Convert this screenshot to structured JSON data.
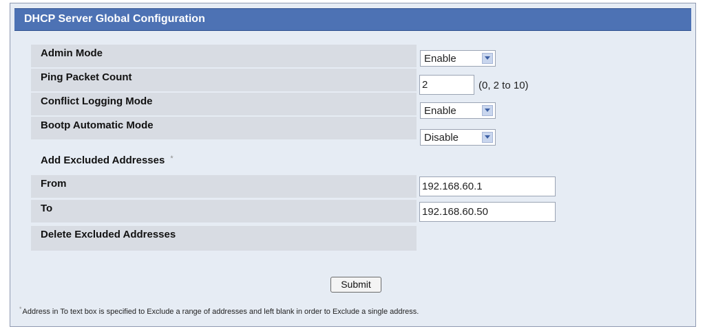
{
  "panel": {
    "title": "DHCP Server Global Configuration"
  },
  "fields": {
    "admin_mode": {
      "label": "Admin Mode",
      "value": "Enable"
    },
    "ping_packet_count": {
      "label": "Ping Packet Count",
      "value": "2",
      "hint": "(0, 2 to 10)"
    },
    "conflict_logging_mode": {
      "label": "Conflict Logging Mode",
      "value": "Enable"
    },
    "bootp_automatic_mode": {
      "label": "Bootp Automatic Mode",
      "value": "Disable"
    },
    "add_excluded": {
      "label": "Add Excluded Addresses",
      "marker": "*"
    },
    "from": {
      "label": "From",
      "value": "192.168.60.1"
    },
    "to": {
      "label": "To",
      "value": "192.168.60.50"
    },
    "delete_excluded": {
      "label": "Delete Excluded Addresses"
    }
  },
  "actions": {
    "submit_label": "Submit"
  },
  "footnote": {
    "marker": "*",
    "text": "Address in To text box is specified to Exclude a range of addresses and left blank in order to Exclude a single address."
  },
  "colors": {
    "header_bg": "#4d72b4",
    "panel_bg": "#e6ecf4",
    "row_label_bg": "#d8dce3"
  }
}
